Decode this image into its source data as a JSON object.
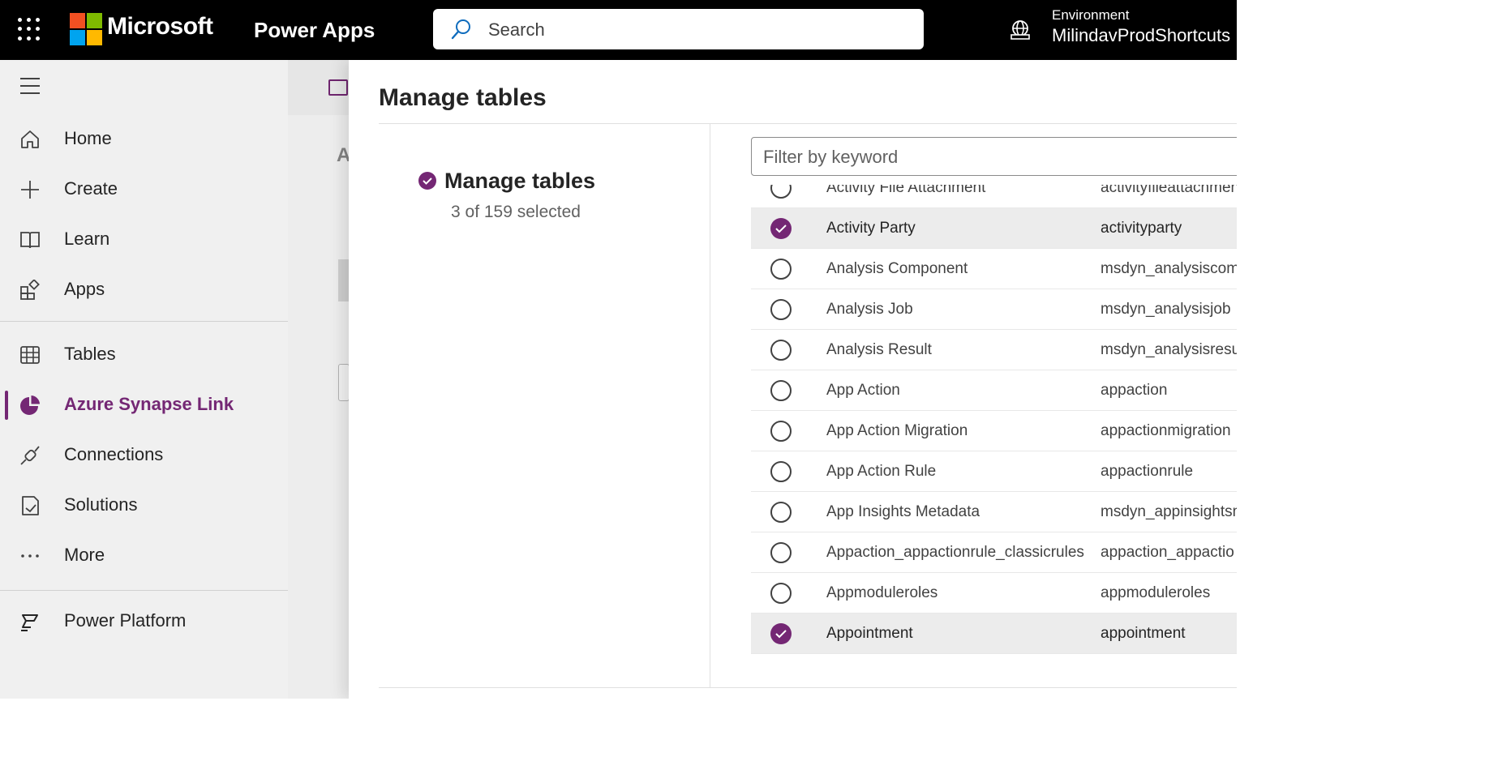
{
  "header": {
    "brand": "Microsoft",
    "product": "Power Apps",
    "search_placeholder": "Search",
    "environment_label": "Environment",
    "environment_name": "MilindavProdShortcuts"
  },
  "brand_colors": [
    "#f25022",
    "#7fba00",
    "#00a4ef",
    "#ffb900"
  ],
  "accent_color": "#742774",
  "nav": {
    "items": [
      {
        "label": "Home",
        "icon": "home-icon"
      },
      {
        "label": "Create",
        "icon": "plus-icon"
      },
      {
        "label": "Learn",
        "icon": "book-icon"
      },
      {
        "label": "Apps",
        "icon": "apps-icon"
      },
      {
        "label": "Tables",
        "icon": "table-icon"
      },
      {
        "label": "Azure Synapse Link",
        "icon": "synapse-icon",
        "active": true
      },
      {
        "label": "Connections",
        "icon": "connection-icon"
      },
      {
        "label": "Solutions",
        "icon": "solutions-icon"
      },
      {
        "label": "More",
        "icon": "ellipsis-icon"
      },
      {
        "label": "Power Platform",
        "icon": "power-platform-icon"
      }
    ]
  },
  "background_page": {
    "heading_fragment": "A"
  },
  "panel": {
    "title": "Manage tables",
    "step_title": "Manage tables",
    "step_subtitle": "3 of 159 selected",
    "filter_placeholder": "Filter by keyword",
    "rows": [
      {
        "name": "Activity File Attachment",
        "logical": "activityfileattachmen",
        "selected": false
      },
      {
        "name": "Activity Party",
        "logical": "activityparty",
        "selected": true
      },
      {
        "name": "Analysis Component",
        "logical": "msdyn_analysiscom",
        "selected": false
      },
      {
        "name": "Analysis Job",
        "logical": "msdyn_analysisjob",
        "selected": false
      },
      {
        "name": "Analysis Result",
        "logical": "msdyn_analysisresul",
        "selected": false
      },
      {
        "name": "App Action",
        "logical": "appaction",
        "selected": false
      },
      {
        "name": "App Action Migration",
        "logical": "appactionmigration",
        "selected": false
      },
      {
        "name": "App Action Rule",
        "logical": "appactionrule",
        "selected": false
      },
      {
        "name": "App Insights Metadata",
        "logical": "msdyn_appinsightsm",
        "selected": false
      },
      {
        "name": "Appaction_appactionrule_classicrules",
        "logical": "appaction_appactio",
        "selected": false
      },
      {
        "name": "Appmoduleroles",
        "logical": "appmoduleroles",
        "selected": false
      },
      {
        "name": "Appointment",
        "logical": "appointment",
        "selected": true
      }
    ]
  }
}
